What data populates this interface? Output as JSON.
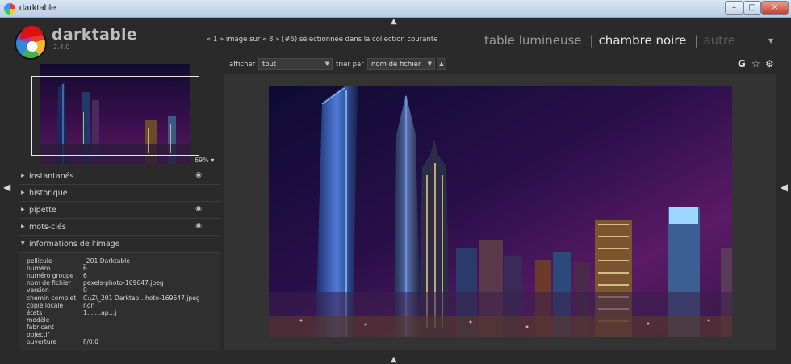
{
  "window": {
    "title": "darktable",
    "controls": {
      "minimize": "–",
      "maximize": "□",
      "close": "✕"
    }
  },
  "header": {
    "brand": "darktable",
    "version": "2.4.0",
    "status": "« 1 » image sur « 8 » (#6) sélectionnée dans la collection courante",
    "views": {
      "lighttable": "table lumineuse",
      "darkroom": "chambre noire",
      "other": "autre",
      "separator": "|"
    }
  },
  "toolbar": {
    "show_label": "afficher",
    "show_value": "tout",
    "sort_label": "trier par",
    "sort_value": "nom de fichier",
    "sort_direction": "▲",
    "icons": [
      "group-icon",
      "star-icon",
      "gear-icon"
    ],
    "group_glyph": "G",
    "star_glyph": "☆",
    "gear_glyph": "⚙"
  },
  "navigator": {
    "zoom": "69% ▾"
  },
  "modules": [
    {
      "label": "instantanés",
      "expanded": false,
      "has_reset": true
    },
    {
      "label": "historique",
      "expanded": false,
      "has_reset": false
    },
    {
      "label": "pipette",
      "expanded": false,
      "has_reset": true
    },
    {
      "label": "mots-clés",
      "expanded": false,
      "has_reset": true
    },
    {
      "label": "informations de l'image",
      "expanded": true,
      "has_reset": false
    }
  ],
  "image_info": [
    {
      "key": "pellicule",
      "value": "_201 Darktable"
    },
    {
      "key": "numéro",
      "value": "6"
    },
    {
      "key": "numéro groupe",
      "value": "6"
    },
    {
      "key": "nom de fichier",
      "value": "pexels-photo-169647.jpeg"
    },
    {
      "key": "version",
      "value": "0"
    },
    {
      "key": "chemin complet",
      "value": "C:\\Z\\_201 Darktab…hoto-169647.jpeg"
    },
    {
      "key": "copie locale",
      "value": "non"
    },
    {
      "key": "états",
      "value": "1…l…ap…j"
    },
    {
      "key": "modèle",
      "value": ""
    },
    {
      "key": "fabricant",
      "value": ""
    },
    {
      "key": "objectif",
      "value": ""
    },
    {
      "key": "ouverture",
      "value": "F/0.0"
    }
  ],
  "colors": {
    "accent": "#e6e6e6",
    "panel": "#2a2a2a",
    "center": "#333333"
  }
}
